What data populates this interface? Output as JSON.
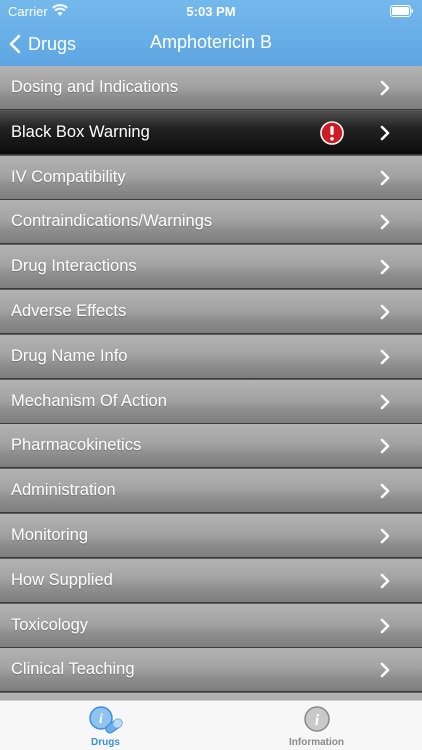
{
  "status_bar": {
    "carrier": "Carrier",
    "time": "5:03 PM"
  },
  "nav": {
    "back_label": "Drugs",
    "title": "Amphotericin B"
  },
  "menu": {
    "items": [
      {
        "label": "Dosing and Indications",
        "alert": false
      },
      {
        "label": "Black Box Warning",
        "alert": true,
        "alert_icon": "exclamation-circle-icon"
      },
      {
        "label": "IV Compatibility",
        "alert": false
      },
      {
        "label": "Contraindications/Warnings",
        "alert": false
      },
      {
        "label": "Drug Interactions",
        "alert": false
      },
      {
        "label": "Adverse Effects",
        "alert": false
      },
      {
        "label": "Drug Name Info",
        "alert": false
      },
      {
        "label": "Mechanism Of Action",
        "alert": false
      },
      {
        "label": "Pharmacokinetics",
        "alert": false
      },
      {
        "label": "Administration",
        "alert": false
      },
      {
        "label": "Monitoring",
        "alert": false
      },
      {
        "label": "How Supplied",
        "alert": false
      },
      {
        "label": "Toxicology",
        "alert": false
      },
      {
        "label": "Clinical Teaching",
        "alert": false
      }
    ]
  },
  "tab_bar": {
    "tabs": [
      {
        "label": "Drugs",
        "icon": "drugs-info-pill-icon",
        "active": true
      },
      {
        "label": "Information",
        "icon": "info-icon",
        "active": false
      }
    ]
  },
  "colors": {
    "header_blue": "#64abe6",
    "active_tab_blue": "#3d8fd8",
    "inactive_tab_gray": "#8a8a8a",
    "alert_red": "#d11b24",
    "selected_row_black": "#1a1a1a"
  }
}
